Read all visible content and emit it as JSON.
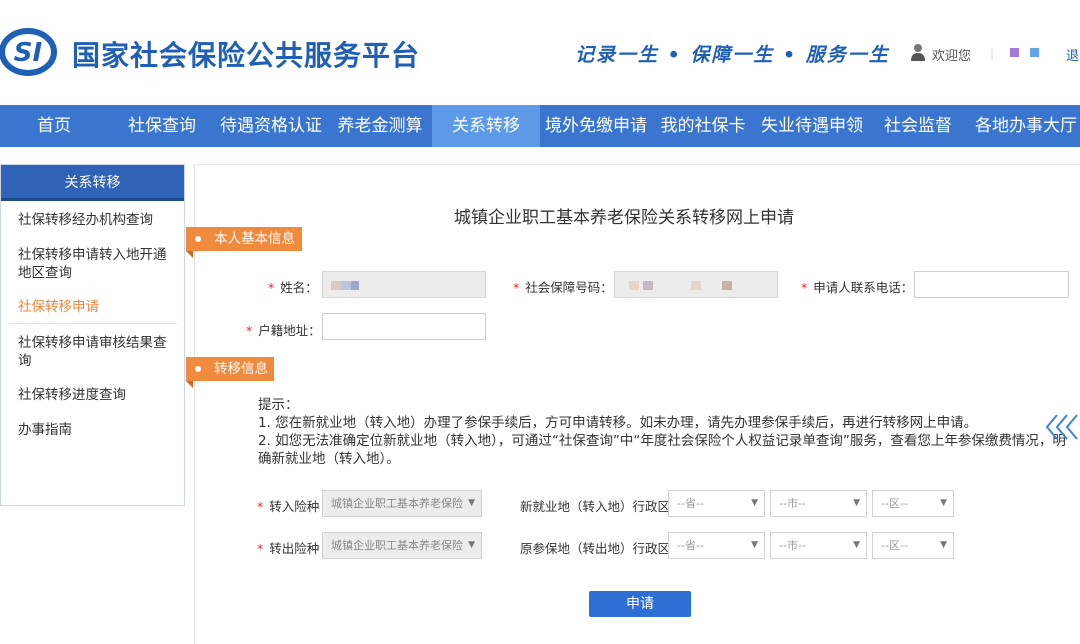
{
  "header": {
    "logo_text": "SI",
    "title": "国家社会保险公共服务平台",
    "slogan": "记录一生 • 保障一生 • 服务一生",
    "welcome": "欢迎您",
    "logout": "退"
  },
  "nav": {
    "items": [
      "首页",
      "社保查询",
      "待遇资格认证",
      "养老金测算",
      "关系转移",
      "境外免缴申请",
      "我的社保卡",
      "失业待遇申领",
      "社会监督",
      "各地办事大厅"
    ],
    "active": "关系转移"
  },
  "sidebar": {
    "title": "关系转移",
    "items": [
      "社保转移经办机构查询",
      "社保转移申请转入地开通地区查询",
      "社保转移申请",
      "社保转移申请审核结果查询",
      "社保转移进度查询",
      "办事指南"
    ],
    "active": "社保转移申请"
  },
  "form": {
    "title": "城镇企业职工基本养老保险关系转移网上申请",
    "section_basic": "本人基本信息",
    "section_transfer": "转移信息",
    "required_mark": "*",
    "name_label": "姓名：",
    "ssn_label": "社会保障号码：",
    "phone_label": "申请人联系电话：",
    "address_label": "户籍地址：",
    "phone_value": "",
    "address_value": "",
    "hint_title": "提示：",
    "hint_1": "1. 您在新就业地（转入地）办理了参保手续后，方可申请转移。如未办理，请先办理参保手续后，再进行转移网上申请。",
    "hint_2": "2. 如您无法准确定位新就业地（转入地），可通过“社保查询”中“年度社会保险个人权益记录单查询”服务，查看您上年参保缴费情况，明确新就业地（转入地）。",
    "transfer_in_label": "转入险种",
    "transfer_in_value": "城镇企业职工基本养老保险",
    "transfer_out_label": "转出险种",
    "transfer_out_value": "城镇企业职工基本养老保险",
    "new_region_label": "新就业地（转入地）行政区",
    "old_region_label": "原参保地（转出地）行政区",
    "province_placeholder": "--省--",
    "city_placeholder": "--市--",
    "district_placeholder": "--区--",
    "submit": "申请"
  },
  "colors": {
    "brand_blue": "#1f5fb5",
    "nav_blue": "#3a76cf",
    "nav_active": "#5c9ae8",
    "orange": "#f08a3c",
    "submit_blue": "#2e6fd4"
  },
  "icons": {
    "logo": "si-logo",
    "user": "user-icon",
    "scroll": "double-chevron-left-icon",
    "dropdown": "chevron-down-icon"
  }
}
